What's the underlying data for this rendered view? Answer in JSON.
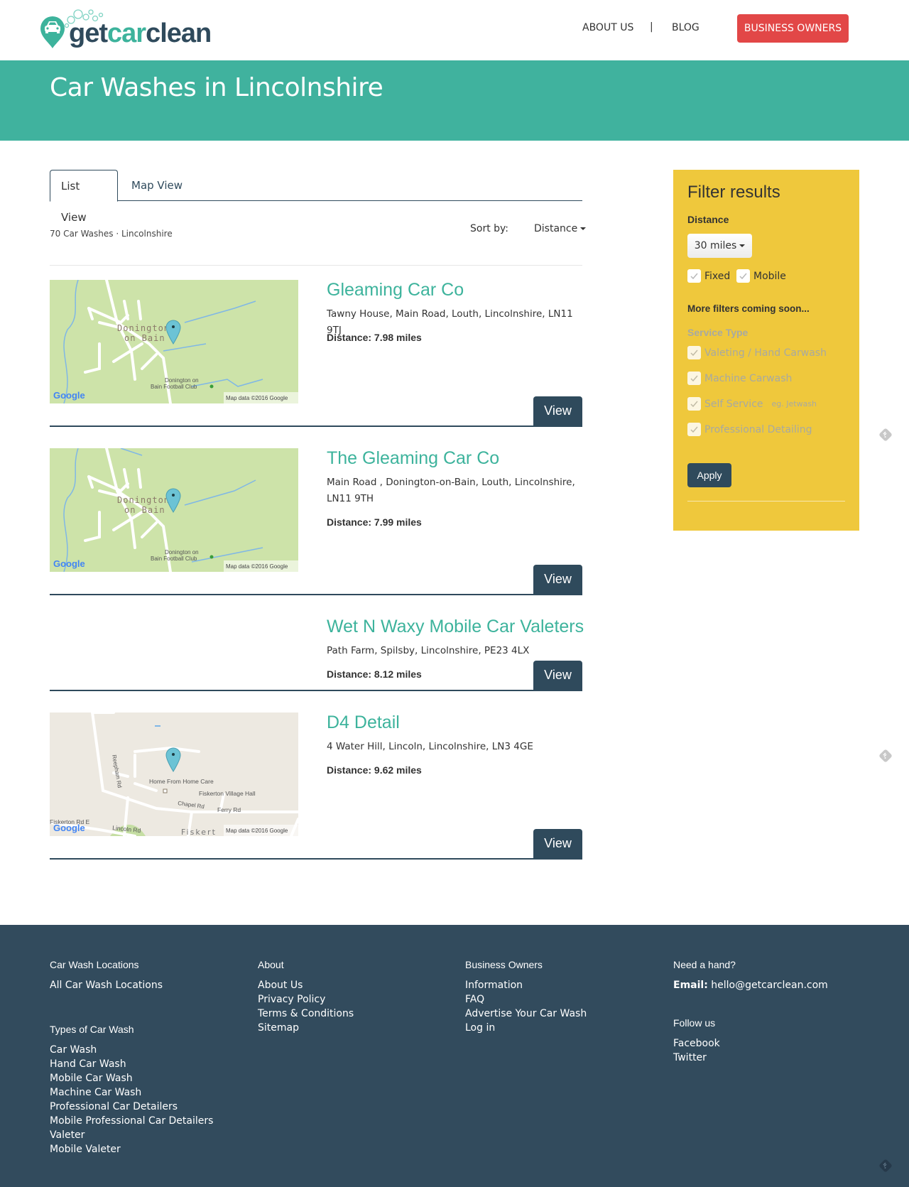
{
  "header": {
    "logo": {
      "prefix": "get",
      "accent": "car",
      "suffix": "clean"
    },
    "nav": {
      "about": "ABOUT US",
      "separator": "|",
      "blog": "BLOG",
      "business": "BUSINESS OWNERS"
    }
  },
  "banner": {
    "title": "Car Washes in Lincolnshire"
  },
  "tabs": [
    {
      "label": "List View",
      "active": true
    },
    {
      "label": "Map View",
      "active": false
    }
  ],
  "results": {
    "summary": "70 Car Washes · Lincolnshire",
    "sort_label": "Sort by:",
    "sort_value": "Distance"
  },
  "listings": [
    {
      "name": "Gleaming Car Co",
      "address": "Tawny House, Main Road, Louth, Lincolnshire, LN11 9TJ",
      "distance": "Distance: 7.98 miles",
      "view": "View",
      "map": {
        "type": "green",
        "label1": "Donington",
        "label2": "on Bain",
        "poi1": "Donington on",
        "poi2": "Bain Football Club",
        "credit": "Map data ©2016 Google",
        "brand": "Google"
      }
    },
    {
      "name": "The Gleaming Car Co",
      "address": "Main Road , Donington-on-Bain, Louth, Lincolnshire, LN11 9TH",
      "distance": "Distance: 7.99 miles",
      "view": "View",
      "map": {
        "type": "green",
        "label1": "Donington",
        "label2": "on Bain",
        "poi1": "Donington on",
        "poi2": "Bain Football Club",
        "credit": "Map data ©2016 Google",
        "brand": "Google"
      }
    },
    {
      "name": "Wet N Waxy Mobile Car Valeters",
      "address": "Path Farm, Spilsby, Lincolnshire, PE23 4LX",
      "distance": "Distance: 8.12 miles",
      "view": "View",
      "map": null
    },
    {
      "name": "D4 Detail",
      "address": "4 Water Hill, Lincoln, Lincolnshire, LN3 4GE",
      "distance": "Distance: 9.62 miles",
      "view": "View",
      "map": {
        "type": "grey",
        "road1": "Reepham Rd",
        "poi1": "Home From Home Care",
        "poi2": "Fiskerton Village Hall",
        "road2": "Chapel Rd",
        "road3": "Ferry Rd",
        "road4": "Fiskerton Rd E",
        "road5": "Lincoln Rd",
        "town": "Fiskert",
        "credit": "Map data ©2016 Google",
        "brand": "Google"
      }
    }
  ],
  "sidebar": {
    "title": "Filter results",
    "distance_label": "Distance",
    "distance_value": "30 miles",
    "type_options": [
      {
        "label": "Fixed",
        "checked": true
      },
      {
        "label": "Mobile",
        "checked": true
      }
    ],
    "coming_soon": "More filters coming soon...",
    "service_label": "Service Type",
    "service_options": [
      {
        "label": "Valeting / Hand Carwash",
        "hint": "",
        "checked": true
      },
      {
        "label": "Machine Carwash",
        "hint": "",
        "checked": true
      },
      {
        "label": "Self Service",
        "hint": "eg. Jetwash",
        "checked": true
      },
      {
        "label": "Professional Detailing",
        "hint": "",
        "checked": true
      }
    ],
    "apply": "Apply"
  },
  "footer": {
    "col1": {
      "heading1": "Car Wash Locations",
      "links1": [
        "All Car Wash Locations"
      ],
      "heading2": "Types of Car Wash",
      "links2": [
        "Car Wash",
        "Hand Car Wash",
        "Mobile Car Wash",
        "Machine Car Wash",
        "Professional Car Detailers",
        "Mobile Professional Car Detailers",
        "Valeter",
        "Mobile Valeter"
      ]
    },
    "col2": {
      "heading": "About",
      "links": [
        "About Us",
        "Privacy Policy",
        "Terms & Conditions",
        "Sitemap"
      ]
    },
    "col3": {
      "heading": "Business Owners",
      "links": [
        "Information",
        "FAQ",
        "Advertise Your Car Wash",
        "Log in"
      ]
    },
    "col4": {
      "heading1": "Need a hand?",
      "email_label": "Email:",
      "email": "hello@getcarclean.com",
      "heading2": "Follow us",
      "links": [
        "Facebook",
        "Twitter"
      ]
    }
  },
  "colors": {
    "teal": "#40b29e",
    "navy": "#2f4a5c",
    "red": "#e24747",
    "yellow": "#efc83c"
  }
}
